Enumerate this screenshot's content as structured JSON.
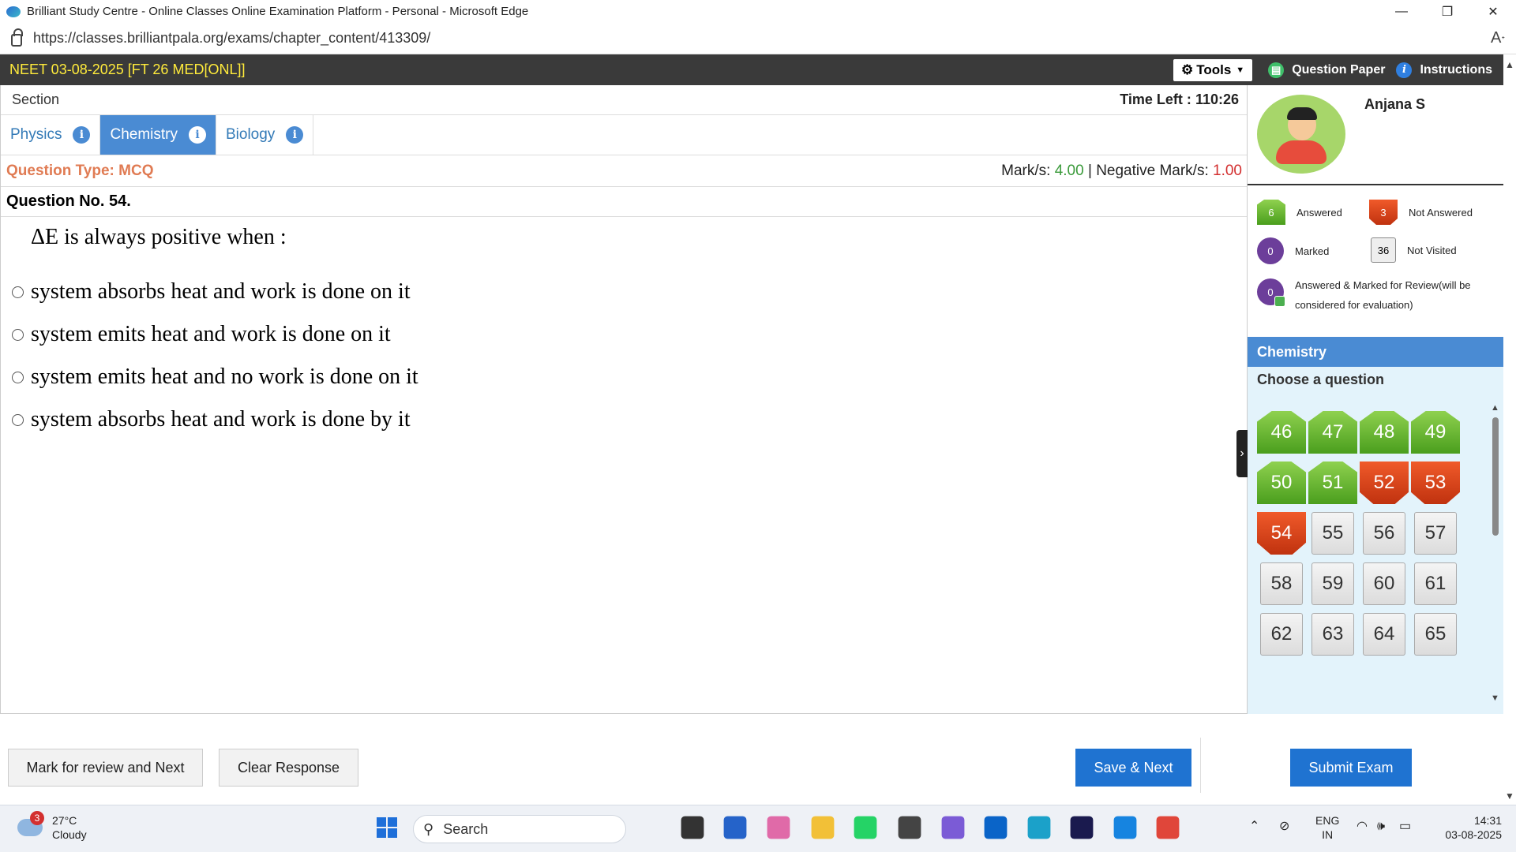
{
  "window": {
    "title": "Brilliant Study Centre - Online Classes Online Examination Platform - Personal - Microsoft Edge",
    "minimize": "—",
    "restore": "❐",
    "close": "✕",
    "url": "https://classes.brilliantpala.org/exams/chapter_content/413309/"
  },
  "header": {
    "exam_name": "NEET 03-08-2025 [FT 26 MED[ONL]]",
    "tools_label": "Tools",
    "question_paper_label": "Question Paper",
    "instructions_label": "Instructions"
  },
  "section": {
    "label": "Section",
    "time_left_label": "Time Left :",
    "time_left_value": "110:26"
  },
  "tabs": [
    {
      "label": "Physics",
      "active": false
    },
    {
      "label": "Chemistry",
      "active": true
    },
    {
      "label": "Biology",
      "active": false
    }
  ],
  "question": {
    "type_label": "Question Type: MCQ",
    "marks_label": "Mark/s:",
    "marks_value": "4.00",
    "separator": "|",
    "negative_label": "Negative Mark/s:",
    "negative_value": "1.00",
    "number_label": "Question No. 54.",
    "text": "ΔE is always positive when :",
    "options": [
      "system absorbs heat and work is done on it",
      "system emits heat and work is done on it",
      "system emits heat and no work is done on it",
      "system absorbs heat and work is done by it"
    ]
  },
  "actions": {
    "mark_review": "Mark for review and Next",
    "clear": "Clear Response",
    "save_next": "Save & Next",
    "submit": "Submit Exam"
  },
  "profile": {
    "name": "Anjana S"
  },
  "legend": {
    "answered_count": "6",
    "answered_label": "Answered",
    "not_answered_count": "3",
    "not_answered_label": "Not Answered",
    "marked_count": "0",
    "marked_label": "Marked",
    "not_visited_count": "36",
    "not_visited_label": "Not Visited",
    "amr_count": "0",
    "amr_label": "Answered & Marked for Review(will be considered for evaluation)"
  },
  "palette": {
    "subject": "Chemistry",
    "choose_label": "Choose a question",
    "questions": [
      {
        "n": "46",
        "status": "answered"
      },
      {
        "n": "47",
        "status": "answered"
      },
      {
        "n": "48",
        "status": "answered"
      },
      {
        "n": "49",
        "status": "answered"
      },
      {
        "n": "50",
        "status": "answered"
      },
      {
        "n": "51",
        "status": "answered"
      },
      {
        "n": "52",
        "status": "notanswered"
      },
      {
        "n": "53",
        "status": "notanswered"
      },
      {
        "n": "54",
        "status": "notanswered"
      },
      {
        "n": "55",
        "status": "notvisited"
      },
      {
        "n": "56",
        "status": "notvisited"
      },
      {
        "n": "57",
        "status": "notvisited"
      },
      {
        "n": "58",
        "status": "notvisited"
      },
      {
        "n": "59",
        "status": "notvisited"
      },
      {
        "n": "60",
        "status": "notvisited"
      },
      {
        "n": "61",
        "status": "notvisited"
      },
      {
        "n": "62",
        "status": "notvisited"
      },
      {
        "n": "63",
        "status": "notvisited"
      },
      {
        "n": "64",
        "status": "notvisited"
      },
      {
        "n": "65",
        "status": "notvisited"
      }
    ]
  },
  "taskbar": {
    "weather_badge": "3",
    "temperature": "27°C",
    "condition": "Cloudy",
    "search_label": "Search",
    "language_line1": "ENG",
    "language_line2": "IN",
    "time": "14:31",
    "date": "03-08-2025",
    "apps": [
      {
        "name": "start-icon",
        "color": "#1e6fd9"
      },
      {
        "name": "task-view-icon",
        "color": "#333333"
      },
      {
        "name": "store-icon",
        "color": "#2563c9"
      },
      {
        "name": "copilot-icon",
        "color": "#e06aa8"
      },
      {
        "name": "file-explorer-icon",
        "color": "#f2c037"
      },
      {
        "name": "whatsapp-icon",
        "color": "#25d366"
      },
      {
        "name": "dell-icon",
        "color": "#444444"
      },
      {
        "name": "m365-icon",
        "color": "#7b5bd6"
      },
      {
        "name": "outlook-icon",
        "color": "#0a64c8"
      },
      {
        "name": "edge-icon",
        "color": "#1ba1c9"
      },
      {
        "name": "webex-icon",
        "color": "#1a1a4e"
      },
      {
        "name": "app-icon",
        "color": "#1684e0"
      },
      {
        "name": "chrome-icon",
        "color": "#e0463a"
      }
    ]
  }
}
